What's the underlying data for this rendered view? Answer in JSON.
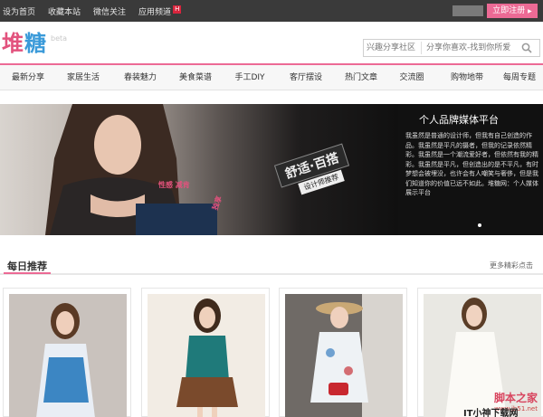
{
  "topbar": {
    "links": [
      {
        "label": "设为首页"
      },
      {
        "label": "收藏本站"
      },
      {
        "label": "微信关注"
      },
      {
        "label": "应用频道",
        "badge": "H"
      }
    ],
    "register_label": "立即注册",
    "register_arrow": "▶"
  },
  "header": {
    "logo_part1": "堆",
    "logo_part2": "糖",
    "beta": "beta",
    "search_scope": "兴趣分享社区",
    "search_placeholder": "分享你喜欢-找到你所爱"
  },
  "nav": {
    "items": [
      {
        "label": "最新分享"
      },
      {
        "label": "家居生活"
      },
      {
        "label": "春装魅力"
      },
      {
        "label": "美食菜谱"
      },
      {
        "label": "手工DIY"
      },
      {
        "label": "客厅摆设"
      },
      {
        "label": "热门文章"
      },
      {
        "label": "交流圈"
      },
      {
        "label": "购物地带"
      },
      {
        "label": "每周专题"
      }
    ]
  },
  "banner": {
    "slogan_main": "舒适·百搭",
    "slogan_sub": "设计师推荐",
    "tag_left": "性感 减肯",
    "tag_right": "独享",
    "title": "个人品牌媒体平台",
    "body": "我虽然是普通的设计师，但我有自己创造的作品。我虽然是平凡的摄者，但我的记录依然精彩。我虽然是一个潮流爱好者，但依然有我的精彩。我虽然是平凡，但创造出的是不平凡，有时梦想会被埋没，也许会有人嘲笑与奢侈，但是我们知道你的价值已远不如此。堆糖网：个人媒体展示平台"
  },
  "section": {
    "title": "每日推荐",
    "more": "更多精彩点击"
  },
  "watermark": {
    "line1": "脚本之家",
    "line2": "www.jb51.net",
    "line3": "IT小神下载网"
  },
  "colors": {
    "accent": "#ec6a95",
    "topbar_bg": "#3a3a3a",
    "logo_pink": "#e2527d",
    "logo_blue": "#3a9ad9"
  },
  "icons": {
    "search": "search-icon"
  }
}
